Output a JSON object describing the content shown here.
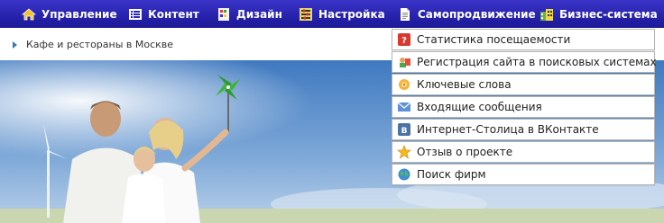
{
  "nav": {
    "items": [
      {
        "label": "Управление",
        "icon": "home-icon"
      },
      {
        "label": "Контент",
        "icon": "list-icon"
      },
      {
        "label": "Дизайн",
        "icon": "design-icon"
      },
      {
        "label": "Настройка",
        "icon": "settings-icon"
      },
      {
        "label": "Самопродвижение",
        "icon": "document-icon",
        "has_dropdown": true
      },
      {
        "label": "Бизнес-система",
        "icon": "business-icon"
      }
    ]
  },
  "breadcrumb": {
    "text": "Кафе и рестораны в Москве"
  },
  "dropdown": {
    "items": [
      {
        "label": "Статистика посещаемости",
        "icon": "stats-icon"
      },
      {
        "label": "Регистрация сайта в поисковых системах",
        "icon": "register-icon"
      },
      {
        "label": "Ключевые слова",
        "icon": "keywords-icon"
      },
      {
        "label": "Входящие сообщения",
        "icon": "mail-icon"
      },
      {
        "label": "Интернет-Столица в ВКонтакте",
        "icon": "vk-icon"
      },
      {
        "label": "Отзыв о проекте",
        "icon": "star-icon"
      },
      {
        "label": "Поиск фирм",
        "icon": "globe-icon"
      }
    ]
  },
  "colors": {
    "nav_bg": "#2a24b8",
    "breadcrumb_arrow": "#2a7db8",
    "sky": "#4f86c8"
  }
}
